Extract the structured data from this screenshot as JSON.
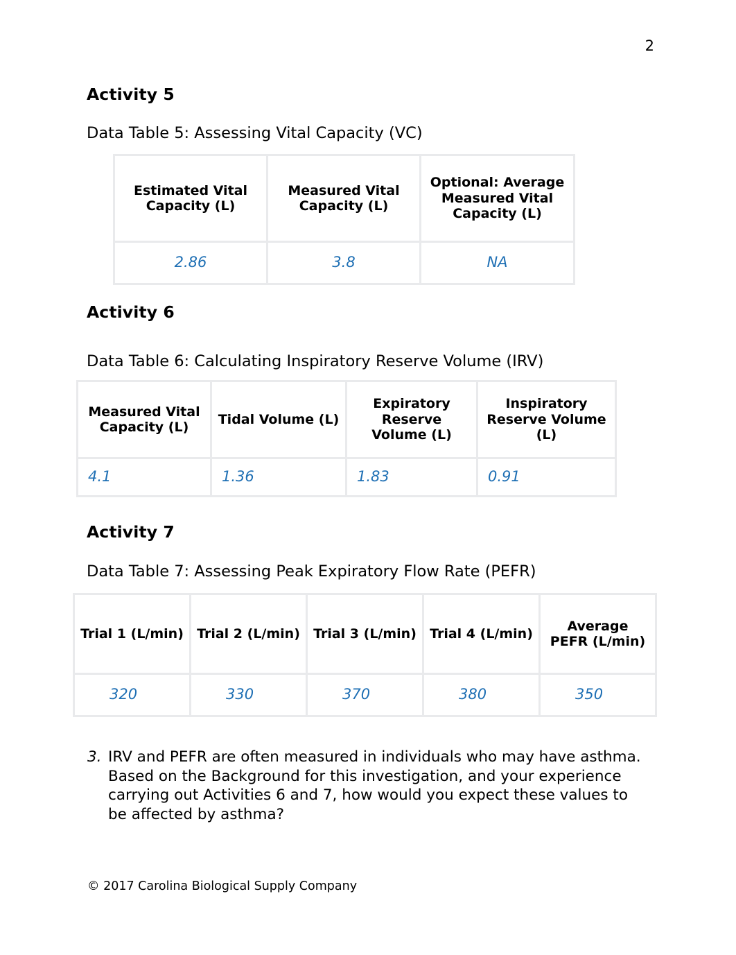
{
  "page": {
    "number": "2",
    "footer": "© 2017 Carolina Biological Supply Company",
    "value_color": "#1e6fb4"
  },
  "activity5": {
    "heading": "Activity 5",
    "caption": "Data Table 5: Assessing Vital Capacity (VC)",
    "table": {
      "headers": [
        "Estimated Vital Capacity (L)",
        "Measured Vital Capacity (L)",
        "Optional: Average Measured Vital Capacity (L)"
      ],
      "values": [
        "2.86",
        "3.8",
        "NA"
      ]
    }
  },
  "activity6": {
    "heading": "Activity 6",
    "caption": "Data Table 6: Calculating Inspiratory Reserve Volume (IRV)",
    "table": {
      "headers": [
        "Measured Vital Capacity (L)",
        "Tidal Volume (L)",
        "Expiratory Reserve Volume (L)",
        "Inspiratory Reserve Volume (L)"
      ],
      "values": [
        "4.1",
        "1.36",
        "1.83",
        "0.91"
      ]
    }
  },
  "activity7": {
    "heading": "Activity 7",
    "caption": "Data Table 7: Assessing Peak Expiratory Flow Rate (PEFR)",
    "table": {
      "headers": [
        "Trial 1 (L/min)",
        "Trial 2 (L/min)",
        "Trial 3 (L/min)",
        "Trial 4 (L/min)",
        "Average PEFR (L/min)"
      ],
      "values": [
        "320",
        "330",
        "370",
        "380",
        "350"
      ]
    }
  },
  "question": {
    "number": "3.",
    "text": "IRV and PEFR are often measured in individuals who may have asthma. Based on the Background for this investigation, and your experience carrying out Activities 6 and 7, how would you expect these values to be affected by asthma?"
  }
}
